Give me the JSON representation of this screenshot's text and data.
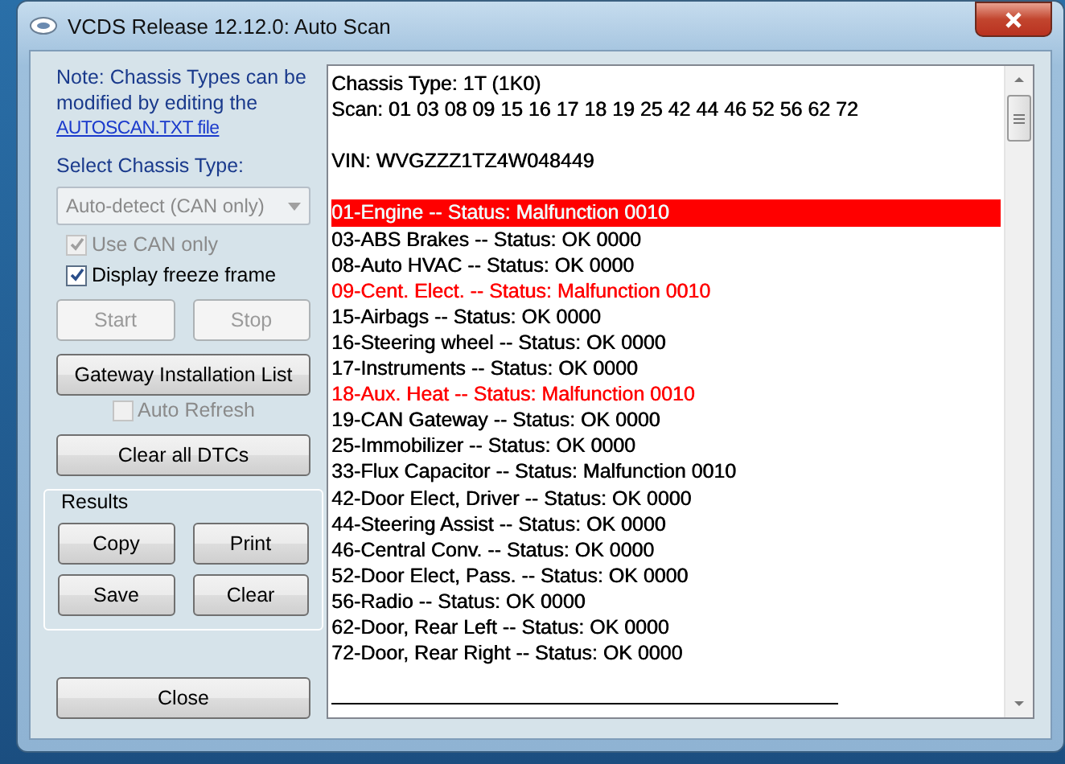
{
  "window": {
    "title": "VCDS Release 12.12.0:  Auto Scan"
  },
  "note": {
    "text": "Note:  Chassis Types can be modified by editing the",
    "link": "AUTOSCAN.TXT file"
  },
  "chassis_select": {
    "label": "Select Chassis Type:",
    "value": "Auto-detect (CAN only)",
    "disabled": true
  },
  "checkboxes": [
    {
      "label": "Use CAN only",
      "checked": true,
      "disabled": true
    },
    {
      "label": "Display freeze frame",
      "checked": true,
      "disabled": false
    }
  ],
  "start_stop": [
    {
      "label": "Start",
      "disabled": true
    },
    {
      "label": "Stop",
      "disabled": true
    }
  ],
  "gateway_button": {
    "label": "Gateway Installation List"
  },
  "auto_refresh": {
    "label": "Auto Refresh",
    "checked": false,
    "disabled": true
  },
  "clear_dtcs_button": {
    "label": "Clear all DTCs"
  },
  "results": {
    "title": "Results",
    "buttons": [
      "Copy",
      "Print",
      "Save",
      "Clear"
    ]
  },
  "close_button": {
    "label": "Close"
  },
  "report": {
    "header": [
      "Chassis Type: 1T (1K0)",
      "Scan: 01 03 08 09 15 16 17 18 19 25 42 44 46 52 56 62 72"
    ],
    "vin": "VIN: WVGZZZ1TZ4W048449",
    "rows": [
      {
        "text": "01-Engine -- Status: Malfunction 0010",
        "color": "#ff0000",
        "selected": true
      },
      {
        "text": "03-ABS Brakes -- Status: OK 0000",
        "color": "#000000",
        "selected": false
      },
      {
        "text": "08-Auto HVAC -- Status: OK 0000",
        "color": "#000000",
        "selected": false
      },
      {
        "text": "09-Cent. Elect. -- Status: Malfunction 0010",
        "color": "#ff0000",
        "selected": false
      },
      {
        "text": "15-Airbags -- Status: OK 0000",
        "color": "#000000",
        "selected": false
      },
      {
        "text": "16-Steering wheel -- Status: OK 0000",
        "color": "#000000",
        "selected": false
      },
      {
        "text": "17-Instruments -- Status: OK 0000",
        "color": "#000000",
        "selected": false
      },
      {
        "text": "18-Aux. Heat -- Status: Malfunction 0010",
        "color": "#ff0000",
        "selected": false
      },
      {
        "text": "19-CAN Gateway -- Status: OK 0000",
        "color": "#000000",
        "selected": false
      },
      {
        "text": "25-Immobilizer -- Status: OK 0000",
        "color": "#000000",
        "selected": false
      },
      {
        "text": "33-Flux Capacitor -- Status: Malfunction 0010",
        "color": "#000000",
        "selected": false
      },
      {
        "text": "42-Door Elect, Driver -- Status: OK 0000",
        "color": "#000000",
        "selected": false
      },
      {
        "text": "44-Steering Assist -- Status: OK 0000",
        "color": "#000000",
        "selected": false
      },
      {
        "text": "46-Central Conv. -- Status: OK 0000",
        "color": "#000000",
        "selected": false
      },
      {
        "text": "52-Door Elect, Pass. -- Status: OK 0000",
        "color": "#000000",
        "selected": false
      },
      {
        "text": "56-Radio -- Status: OK 0000",
        "color": "#000000",
        "selected": false
      },
      {
        "text": "62-Door, Rear Left -- Status: OK 0000",
        "color": "#000000",
        "selected": false
      },
      {
        "text": "72-Door, Rear Right -- Status: OK 0000",
        "color": "#000000",
        "selected": false
      }
    ]
  }
}
